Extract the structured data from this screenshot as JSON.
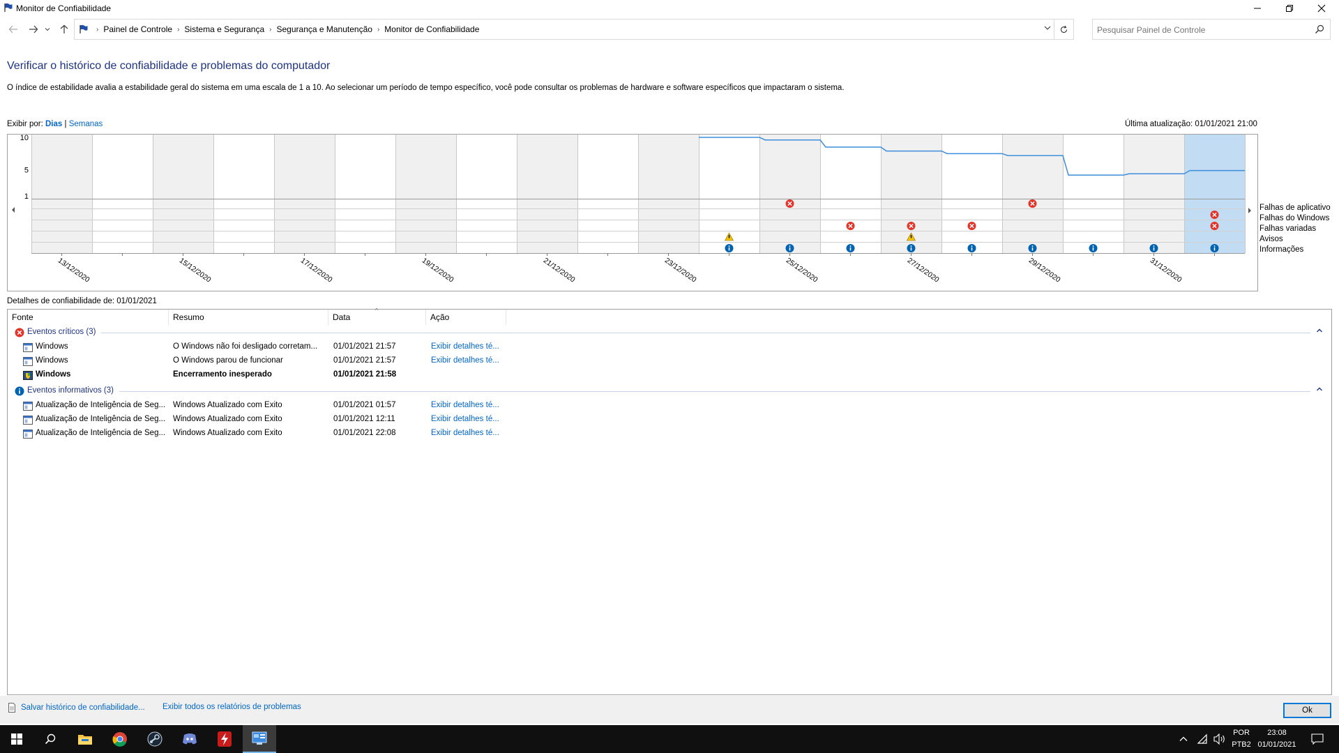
{
  "window": {
    "title": "Monitor de Confiabilidade",
    "minimize_icon": "minimize-icon",
    "maximize_icon": "restore-icon",
    "close_icon": "close-icon"
  },
  "address": {
    "breadcrumbs": [
      "Painel de Controle",
      "Sistema e Segurança",
      "Segurança e Manutenção",
      "Monitor de Confiabilidade"
    ],
    "search_placeholder": "Pesquisar Painel de Controle"
  },
  "page": {
    "title": "Verificar o histórico de confiabilidade e problemas do computador",
    "description": "O índice de estabilidade avalia a estabilidade geral do sistema em uma escala de 1 a 10. Ao selecionar um período de tempo específico, você pode consultar os problemas de hardware e software específicos que impactaram o sistema.",
    "view_by_label": "Exibir por:",
    "view_days": "Dias",
    "view_sep": "|",
    "view_weeks": "Semanas",
    "last_update": "Última atualização: 01/01/2021 21:00"
  },
  "chart_data": {
    "type": "line",
    "ylim": [
      1,
      10
    ],
    "y_ticks": [
      "10",
      "5",
      "1"
    ],
    "date_labels": [
      "13/12/2020",
      "15/12/2020",
      "17/12/2020",
      "19/12/2020",
      "21/12/2020",
      "23/12/2020",
      "25/12/2020",
      "27/12/2020",
      "29/12/2020",
      "31/12/2020"
    ],
    "categories": [
      "13/12/2020",
      "14/12/2020",
      "15/12/2020",
      "16/12/2020",
      "17/12/2020",
      "18/12/2020",
      "19/12/2020",
      "20/12/2020",
      "21/12/2020",
      "22/12/2020",
      "23/12/2020",
      "24/12/2020",
      "25/12/2020",
      "26/12/2020",
      "27/12/2020",
      "28/12/2020",
      "29/12/2020",
      "30/12/2020",
      "31/12/2020",
      "01/01/2021"
    ],
    "selected_index": 19,
    "stability_index": [
      null,
      null,
      null,
      null,
      null,
      null,
      null,
      null,
      null,
      null,
      null,
      10,
      9.6,
      8.5,
      7.9,
      7.5,
      7.2,
      4.2,
      4.4,
      4.9
    ],
    "event_rows": [
      "Falhas de aplicativo",
      "Falhas do Windows",
      "Falhas variadas",
      "Avisos",
      "Informações"
    ],
    "events": [
      {
        "day": "24/12/2020",
        "row": "Avisos"
      },
      {
        "day": "24/12/2020",
        "row": "Informações"
      },
      {
        "day": "25/12/2020",
        "row": "Falhas de aplicativo"
      },
      {
        "day": "25/12/2020",
        "row": "Informações"
      },
      {
        "day": "26/12/2020",
        "row": "Falhas variadas"
      },
      {
        "day": "26/12/2020",
        "row": "Informações"
      },
      {
        "day": "27/12/2020",
        "row": "Falhas variadas"
      },
      {
        "day": "27/12/2020",
        "row": "Avisos"
      },
      {
        "day": "27/12/2020",
        "row": "Informações"
      },
      {
        "day": "28/12/2020",
        "row": "Falhas variadas"
      },
      {
        "day": "28/12/2020",
        "row": "Informações"
      },
      {
        "day": "29/12/2020",
        "row": "Falhas de aplicativo"
      },
      {
        "day": "29/12/2020",
        "row": "Informações"
      },
      {
        "day": "30/12/2020",
        "row": "Informações"
      },
      {
        "day": "31/12/2020",
        "row": "Informações"
      },
      {
        "day": "01/01/2021",
        "row": "Falhas do Windows"
      },
      {
        "day": "01/01/2021",
        "row": "Falhas variadas"
      },
      {
        "day": "01/01/2021",
        "row": "Informações"
      }
    ],
    "colors": {
      "line": "#3c8ddc",
      "selected": "#c2dcf4",
      "shade": "#f0f0f0",
      "error": "#e3342a",
      "info": "#0063b1",
      "warn": "#f2c200"
    }
  },
  "details": {
    "title": "Detalhes de confiabilidade de: 01/01/2021",
    "columns": [
      "Fonte",
      "Resumo",
      "Data",
      "Ação"
    ],
    "groups": [
      {
        "title": "Eventos críticos (3)",
        "icon": "error-icon",
        "rows": [
          {
            "source": "Windows",
            "summary": "O Windows não foi desligado corretam...",
            "date": "01/01/2021 21:57",
            "action": "Exibir detalhes té...",
            "bold": false,
            "icon": "app-window-icon"
          },
          {
            "source": "Windows",
            "summary": "O Windows parou de funcionar",
            "date": "01/01/2021 21:57",
            "action": "Exibir detalhes té...",
            "bold": false,
            "icon": "app-window-icon"
          },
          {
            "source": "Windows",
            "summary": "Encerramento inesperado",
            "date": "01/01/2021 21:58",
            "action": "",
            "bold": true,
            "icon": "windows-shield-icon"
          }
        ]
      },
      {
        "title": "Eventos informativos (3)",
        "icon": "info-icon",
        "rows": [
          {
            "source": "Atualização de Inteligência de Seg...",
            "summary": "Windows Atualizado com Êxito",
            "date": "01/01/2021 01:57",
            "action": "Exibir detalhes té...",
            "bold": false,
            "icon": "app-window-icon"
          },
          {
            "source": "Atualização de Inteligência de Seg...",
            "summary": "Windows Atualizado com Êxito",
            "date": "01/01/2021 12:11",
            "action": "Exibir detalhes té...",
            "bold": false,
            "icon": "app-window-icon"
          },
          {
            "source": "Atualização de Inteligência de Seg...",
            "summary": "Windows Atualizado com Êxito",
            "date": "01/01/2021 22:08",
            "action": "Exibir detalhes té...",
            "bold": false,
            "icon": "app-window-icon"
          }
        ]
      }
    ]
  },
  "footer": {
    "save_link": "Salvar histórico de confiabilidade...",
    "all_reports_link": "Exibir todos os relatórios de problemas",
    "ok_button": "Ok"
  },
  "taskbar": {
    "apps": [
      "start-icon",
      "search-icon",
      "file-explorer-icon",
      "chrome-icon",
      "steam-icon",
      "discord-icon",
      "red-app-icon",
      "control-panel-icon"
    ],
    "lang_1": "POR",
    "lang_2": "PTB2",
    "time": "23:08",
    "date": "01/01/2021"
  }
}
